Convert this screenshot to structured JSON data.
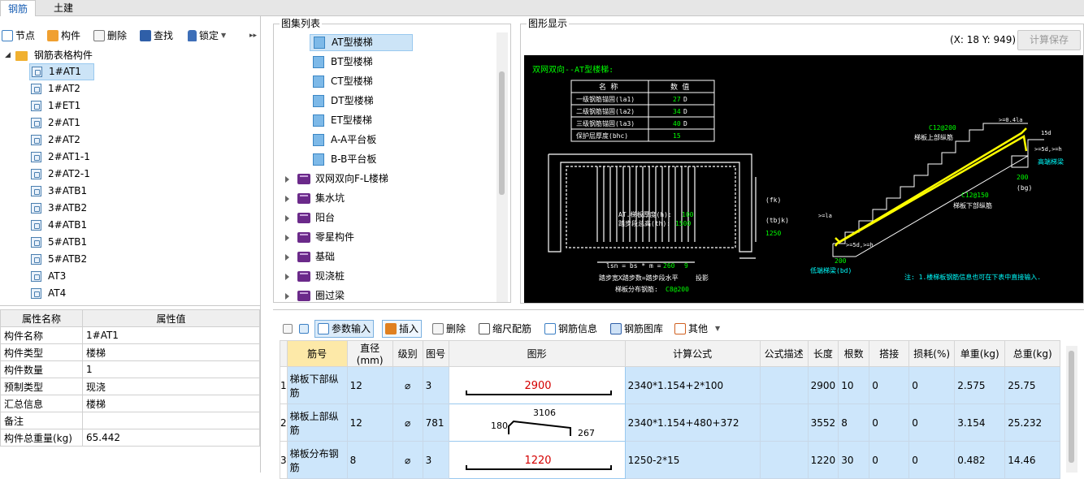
{
  "tabs": [
    {
      "label": "钢筋"
    },
    {
      "label": "土建"
    }
  ],
  "toolbar": {
    "node": "节点",
    "component": "构件",
    "delete": "删除",
    "find": "查找",
    "lock": "锁定",
    "more": "▸▸"
  },
  "tree": {
    "root": "钢筋表格构件",
    "items": [
      {
        "label": "1#AT1"
      },
      {
        "label": "1#AT2"
      },
      {
        "label": "1#ET1"
      },
      {
        "label": "2#AT1"
      },
      {
        "label": "2#AT2"
      },
      {
        "label": "2#AT1-1"
      },
      {
        "label": "2#AT2-1"
      },
      {
        "label": "3#ATB1"
      },
      {
        "label": "3#ATB2"
      },
      {
        "label": "4#ATB1"
      },
      {
        "label": "5#ATB1"
      },
      {
        "label": "5#ATB2"
      },
      {
        "label": "AT3"
      },
      {
        "label": "AT4"
      }
    ]
  },
  "properties": {
    "header_name": "属性名称",
    "header_value": "属性值",
    "rows": [
      {
        "name": "构件名称",
        "value": "1#AT1"
      },
      {
        "name": "构件类型",
        "value": "楼梯"
      },
      {
        "name": "构件数量",
        "value": "1"
      },
      {
        "name": "预制类型",
        "value": "现浇"
      },
      {
        "name": "汇总信息",
        "value": "楼梯"
      },
      {
        "name": "备注",
        "value": ""
      },
      {
        "name": "构件总重量(kg)",
        "value": "65.442"
      }
    ]
  },
  "atlas": {
    "title": "图集列表",
    "items": [
      {
        "label": "AT型楼梯",
        "kind": "page"
      },
      {
        "label": "BT型楼梯",
        "kind": "page"
      },
      {
        "label": "CT型楼梯",
        "kind": "page"
      },
      {
        "label": "DT型楼梯",
        "kind": "page"
      },
      {
        "label": "ET型楼梯",
        "kind": "page"
      },
      {
        "label": "A-A平台板",
        "kind": "page"
      },
      {
        "label": "B-B平台板",
        "kind": "page"
      },
      {
        "label": "双网双向F-L楼梯",
        "kind": "book"
      },
      {
        "label": "集水坑",
        "kind": "book"
      },
      {
        "label": "阳台",
        "kind": "book"
      },
      {
        "label": "零星构件",
        "kind": "book"
      },
      {
        "label": "基础",
        "kind": "book"
      },
      {
        "label": "现浇桩",
        "kind": "book"
      },
      {
        "label": "圈过梁",
        "kind": "book"
      }
    ]
  },
  "graphic": {
    "title": "图形显示",
    "coords": "(X: 18 Y: 949)",
    "save_button": "计算保存",
    "heading": "双网双向--AT型楼梯:",
    "table_header": [
      "名  称",
      "数  值"
    ],
    "table_rows": [
      {
        "name": "一级钢筋锚固(la1)",
        "value": "27",
        "unit": "D"
      },
      {
        "name": "二级钢筋锚固(la2)",
        "value": "34",
        "unit": "D"
      },
      {
        "name": "三级钢筋锚固(la3)",
        "value": "40",
        "unit": "D"
      },
      {
        "name": "保护层厚度(bhc)",
        "value": "15",
        "unit": ""
      }
    ],
    "labels": {
      "thickness": "AT.梯板厚度(h):",
      "thickness_val": "100",
      "step_height": "踏步段总高(th):",
      "step_height_val": "1500",
      "lsn": "lsn = bs * m =",
      "lsn_val": "260",
      "lsn_m": "9",
      "step_note": "踏步宽X踏步数=踏步段水平",
      "step_note2": "投影",
      "dist_bar": "梯板分布钢筋:",
      "dist_bar_val": "C8@200",
      "fk": "(fk)",
      "tbjk": "(tbjk)",
      "v1250": "1250",
      "top_bar": "C12@200",
      "top_bar_label": "梯板上部纵筋",
      "bottom_bar": "C12@150",
      "bottom_bar_label": "梯板下部纵筋",
      "high_beam": "高端梯梁",
      "low_beam": "低端梯梁(bd)",
      "v200a": "200",
      "v200b": "200",
      "bg": "(bg)",
      "dim1": ">=0.4la",
      "dim2": ">=5d,>=h",
      "dim3": ">=la",
      "dim4": ">=5d,>=h",
      "dim5": "15d",
      "note": "注: 1.楼梯板钢筋信息也可在下表中直接输入."
    }
  },
  "grid_toolbar": {
    "param_input": "参数输入",
    "insert": "插入",
    "delete": "删除",
    "scale": "缩尺配筋",
    "rebar_info": "钢筋信息",
    "rebar_lib": "钢筋图库",
    "other": "其他"
  },
  "grid": {
    "headers": [
      "筋号",
      "直径(mm)",
      "级别",
      "图号",
      "图形",
      "计算公式",
      "公式描述",
      "长度",
      "根数",
      "搭接",
      "损耗(%)",
      "单重(kg)",
      "总重(kg)"
    ],
    "rows": [
      {
        "no": "1",
        "name": "梯板下部纵筋",
        "dia": "12",
        "grade": "⌀",
        "fig": "3",
        "shape_val": "2900",
        "formula": "2340*1.154+2*100",
        "desc": "",
        "len": "2900",
        "count": "10",
        "lap": "0",
        "loss": "0",
        "unit_w": "2.575",
        "total_w": "25.75"
      },
      {
        "no": "2",
        "name": "梯板上部纵筋",
        "dia": "12",
        "grade": "⌀",
        "fig": "781",
        "shape_val": "3106",
        "shape_l": "180",
        "shape_r": "267",
        "formula": "2340*1.154+480+372",
        "desc": "",
        "len": "3552",
        "count": "8",
        "lap": "0",
        "loss": "0",
        "unit_w": "3.154",
        "total_w": "25.232"
      },
      {
        "no": "3",
        "name": "梯板分布钢筋",
        "dia": "8",
        "grade": "⌀",
        "fig": "3",
        "shape_val": "1220",
        "formula": "1250-2*15",
        "desc": "",
        "len": "1220",
        "count": "30",
        "lap": "0",
        "loss": "0",
        "unit_w": "0.482",
        "total_w": "14.46"
      }
    ]
  },
  "colors": {
    "accent": "#1a5fb4",
    "selection": "#cce4f7",
    "cad_yellow": "#ffff00",
    "cad_green": "#00ff00",
    "cad_cyan": "#00ffff",
    "shape_red": "#d40000"
  }
}
